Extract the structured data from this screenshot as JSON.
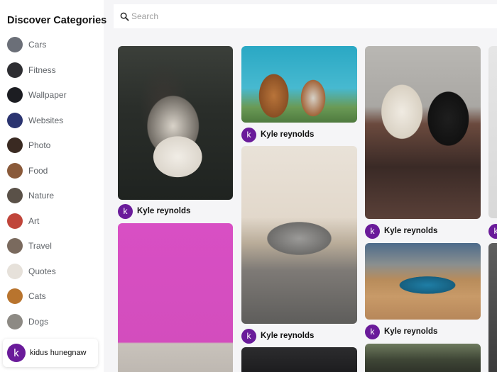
{
  "sidebar": {
    "title": "Discover Categories",
    "categories": [
      {
        "label": "Cars",
        "color": "#6b6f78"
      },
      {
        "label": "Fitness",
        "color": "#2e2e32"
      },
      {
        "label": "Wallpaper",
        "color": "#1c1d22"
      },
      {
        "label": "Websites",
        "color": "#2b3470"
      },
      {
        "label": "Photo",
        "color": "#3a2a22"
      },
      {
        "label": "Food",
        "color": "#8a5a3a"
      },
      {
        "label": "Nature",
        "color": "#5a5148"
      },
      {
        "label": "Art",
        "color": "#c0453a"
      },
      {
        "label": "Travel",
        "color": "#7a6a5e"
      },
      {
        "label": "Quotes",
        "color": "#e6e1da"
      },
      {
        "label": "Cats",
        "color": "#b8742e"
      },
      {
        "label": "Dogs",
        "color": "#8d8a84"
      }
    ],
    "user": {
      "initial": "k",
      "name": "kidus hunegnaw"
    }
  },
  "search": {
    "placeholder": "Search",
    "value": ""
  },
  "pins": [
    {
      "author_initial": "k",
      "author": "Kyle reynolds",
      "subject": "husky"
    },
    {
      "author_initial": "k",
      "author": "Kyle reynolds",
      "subject": "dogs-sky"
    },
    {
      "author_initial": "k",
      "author": "Kyle reynolds",
      "subject": "car"
    },
    {
      "author_initial": "k",
      "author": "Kyle reynolds",
      "subject": "lab-dogs"
    },
    {
      "author_initial": "k",
      "author": "Kyle reynolds",
      "subject": "blue-car"
    }
  ],
  "colors": {
    "avatar": "#6a1b9a",
    "background": "#f5f5f7"
  }
}
